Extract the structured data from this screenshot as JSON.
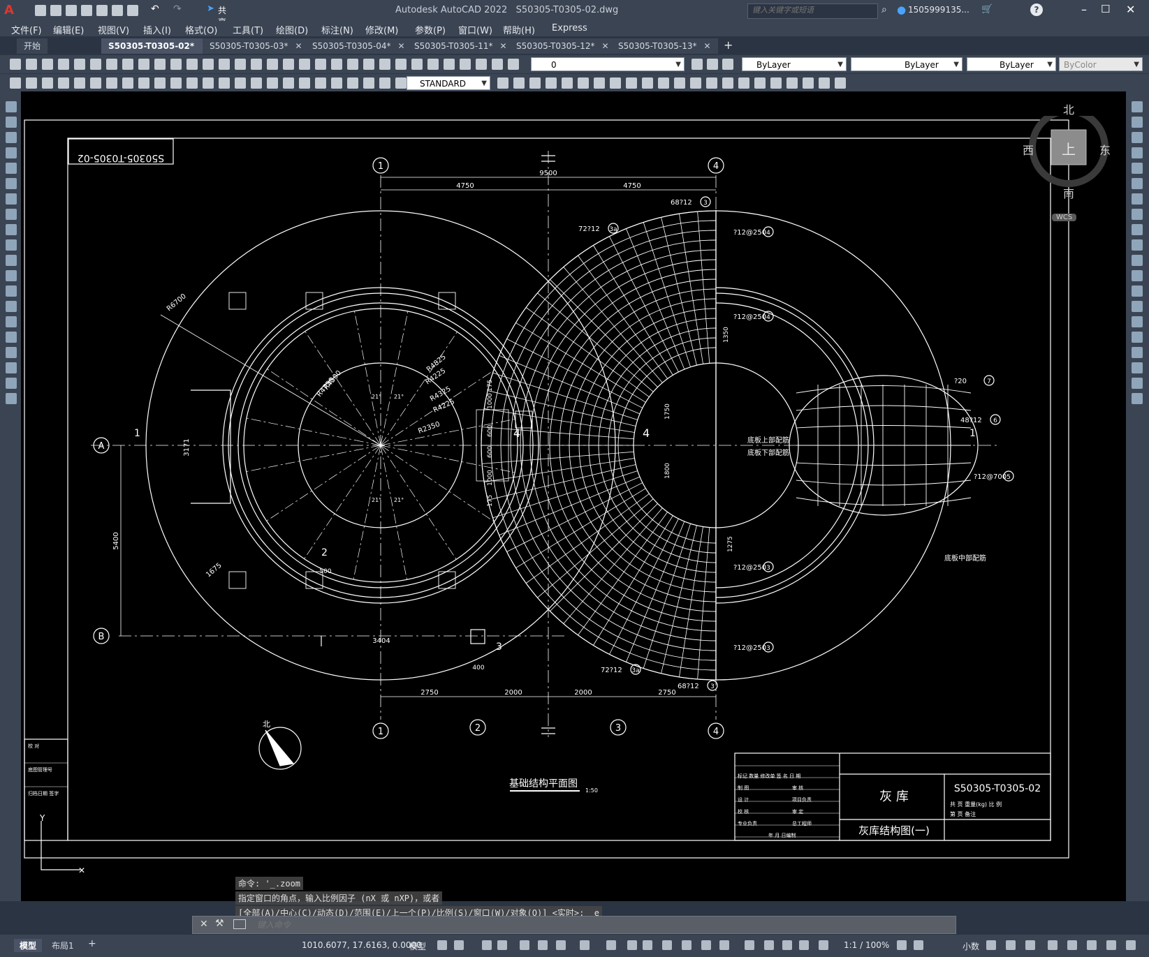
{
  "app": {
    "title": "Autodesk AutoCAD 2022",
    "filename": "S50305-T0305-02.dwg",
    "share_label": "共享",
    "search_placeholder": "键入关键字或短语",
    "user": "1505999135...",
    "logo_letter": "A"
  },
  "menu": [
    "文件(F)",
    "编辑(E)",
    "视图(V)",
    "插入(I)",
    "格式(O)",
    "工具(T)",
    "绘图(D)",
    "标注(N)",
    "修改(M)",
    "参数(P)",
    "窗口(W)",
    "帮助(H)",
    "Express"
  ],
  "tabs": [
    {
      "label": "开始",
      "active": false,
      "closable": false
    },
    {
      "label": "S50305-T0305-02*",
      "active": true,
      "closable": true
    },
    {
      "label": "S50305-T0305-03*",
      "active": false,
      "closable": true
    },
    {
      "label": "S50305-T0305-04*",
      "active": false,
      "closable": true
    },
    {
      "label": "S50305-T0305-11*",
      "active": false,
      "closable": true
    },
    {
      "label": "S50305-T0305-12*",
      "active": false,
      "closable": true
    },
    {
      "label": "S50305-T0305-13*",
      "active": false,
      "closable": true
    }
  ],
  "toolbar": {
    "layer_value": "0",
    "color_value": "ByLayer",
    "linetype_value": "ByLayer",
    "lineweight_value": "ByLayer",
    "plotstyle_value": "ByColor",
    "textstyle_value": "STANDARD"
  },
  "viewcube": {
    "north": "北",
    "south": "南",
    "east": "东",
    "west": "西",
    "top": "上",
    "wcs": "WCS"
  },
  "drawing": {
    "sheet_id": "S50305-T0305-02",
    "grid_numbers": [
      "1",
      "2",
      "3",
      "4"
    ],
    "grid_letters": [
      "A",
      "B"
    ],
    "dims_top": [
      "9500",
      "4750",
      "4750"
    ],
    "dims_bottom": [
      "2750",
      "2000",
      "2000",
      "2750"
    ],
    "dim_5400": "5400",
    "dim_3171": "3171",
    "dim_3404": "3404",
    "dim_1675": "1675",
    "dim_400": "400",
    "dim_500": "500",
    "radii": [
      "R6700",
      "R4500",
      "R4750",
      "R4825",
      "R4225",
      "R4325",
      "R4225",
      "R2350"
    ],
    "angles": [
      "21°",
      "21°",
      "21°",
      "21°"
    ],
    "rebar": [
      "68?12",
      "72?12",
      "?12@250",
      "?12@250",
      "?12@250",
      "?12@250",
      "?12@700",
      "?20",
      "48?12",
      "72?12",
      "68?12"
    ],
    "rebar_labels": [
      "3",
      "3a",
      "4",
      "4",
      "3",
      "3",
      "5",
      "7",
      "6",
      "3a",
      "3"
    ],
    "vert_dims": [
      "175",
      "1000",
      "600",
      "600",
      "1000",
      "175"
    ],
    "dims_mid": [
      "1350",
      "1750",
      "1800",
      "1275"
    ],
    "note_top": "底板上部配筋",
    "note_bottom": "底板下部配筋",
    "note_mid": "底板中部配筋",
    "section_1": "1",
    "section_2": "2",
    "section_3": "3",
    "section_4": "4",
    "plan_title": "基础结构平面图",
    "plan_scale": "1:50",
    "north_label": "北",
    "title_block": {
      "project": "灰 库",
      "drawing_name": "灰库结构图(一)",
      "drawing_no": "S50305-T0305-02",
      "rows": [
        "标记 数量 修改单 签 名 日 期",
        "制 图",
        "设 计",
        "校 核",
        "专业负责"
      ],
      "roles": [
        "审 核",
        "项目负责",
        "审 定",
        "总工程师"
      ],
      "stamp": "年 月 日编制",
      "sheet_info": "共 页 重量(kg) 比 例",
      "sheet_info2": "第 页 备注"
    },
    "left_block": [
      "校 对",
      "底图管理号",
      "归档日期 签字"
    ]
  },
  "command": {
    "history": [
      "命令: '_.zoom",
      "指定窗口的角点，输入比例因子 (nX 或 nXP)，或者",
      "[全部(A)/中心(C)/动态(D)/范围(E)/上一个(P)/比例(S)/窗口(W)/对象(O)] <实时>: _e"
    ],
    "placeholder": "键入命令"
  },
  "status": {
    "model_tab": "模型",
    "layout_tab": "布局1",
    "coords": "1010.6077, 17.6163, 0.0000",
    "mode": "模型",
    "scale": "1:1 / 100%",
    "units": "小数"
  },
  "colors": {
    "accent": "#1a7fd4",
    "canvas": "#000000",
    "chrome": "#3b4453"
  }
}
